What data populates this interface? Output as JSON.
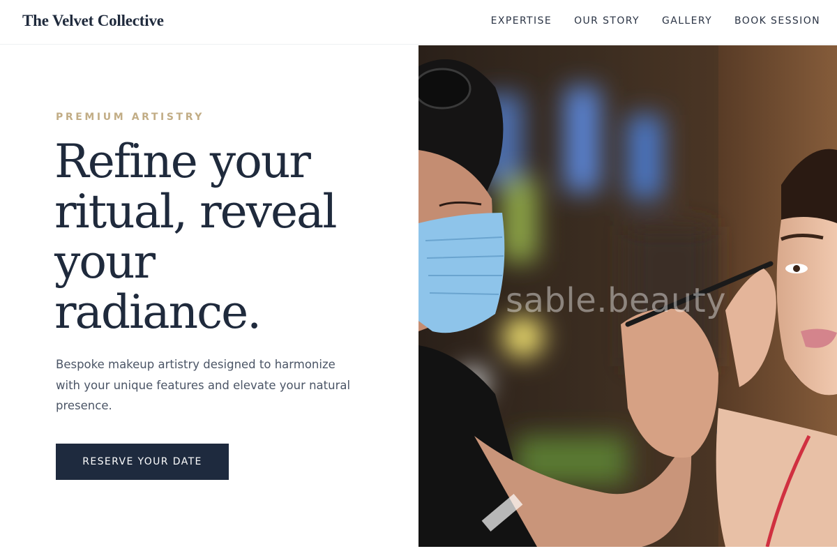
{
  "header": {
    "brand": "The Velvet Collective",
    "nav": [
      "EXPERTISE",
      "OUR STORY",
      "GALLERY",
      "BOOK SESSION"
    ]
  },
  "hero": {
    "eyebrow": "PREMIUM ARTISTRY",
    "headline_lines": [
      "Refine your",
      "ritual, reveal",
      "your",
      "radiance."
    ],
    "subtext": "Bespoke makeup artistry designed to harmonize with your unique features and elevate your natural presence.",
    "cta_label": "RESERVE YOUR DATE"
  },
  "image": {
    "watermark": "sable.beauty"
  },
  "colors": {
    "navy": "#1e2a3e",
    "gold": "#c2ad86",
    "body_text": "#4b5566"
  }
}
